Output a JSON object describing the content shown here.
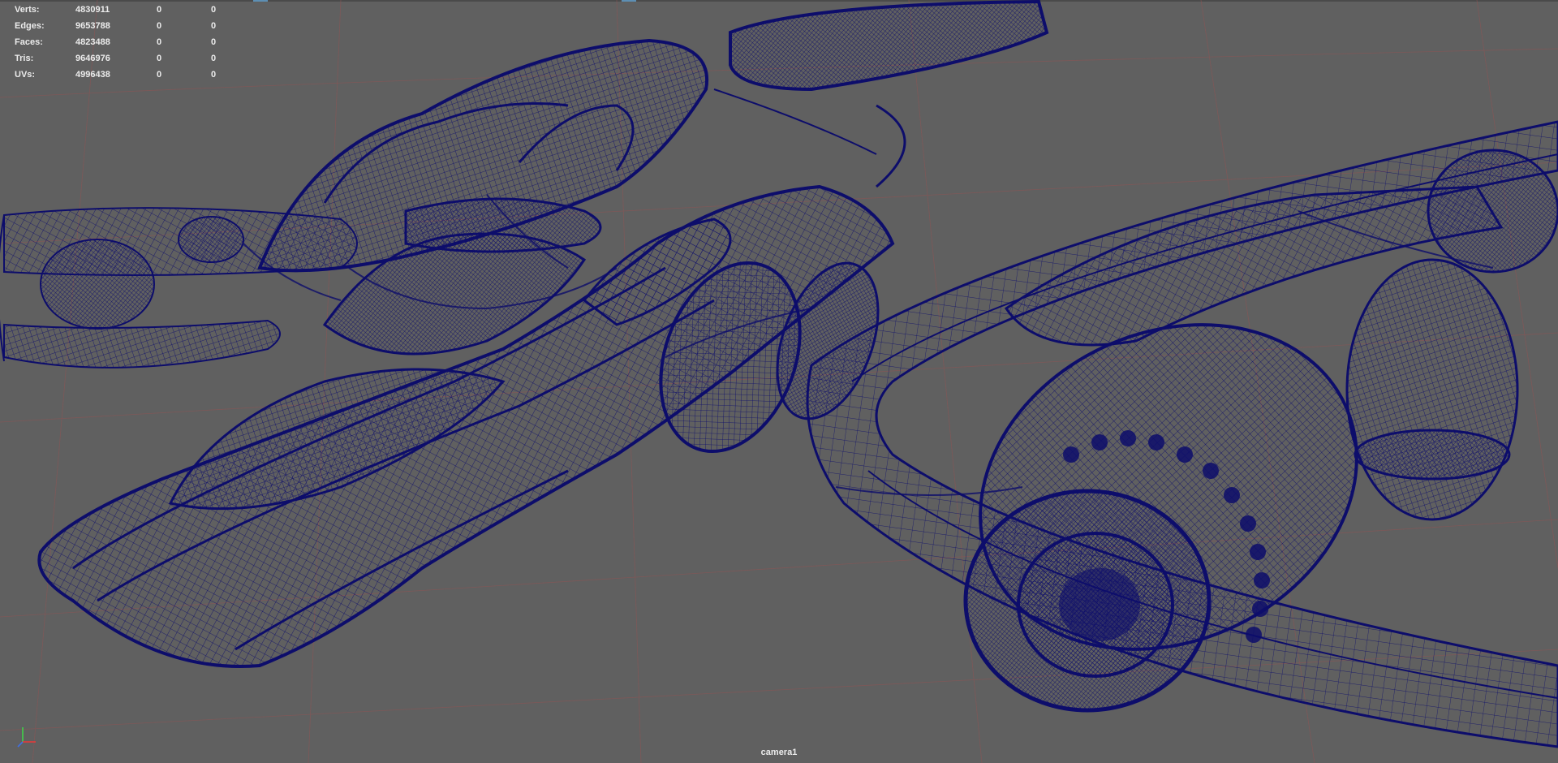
{
  "viewport": {
    "camera_name": "camera1",
    "background_color": "#606060",
    "wireframe_color": "#0d0d6b",
    "grid_line_color": "#8a5555"
  },
  "heads_up_display": {
    "rows": [
      {
        "label": "Verts:",
        "total": "4830911",
        "selected": "0",
        "component": "0"
      },
      {
        "label": "Edges:",
        "total": "9653788",
        "selected": "0",
        "component": "0"
      },
      {
        "label": "Faces:",
        "total": "4823488",
        "selected": "0",
        "component": "0"
      },
      {
        "label": "Tris:",
        "total": "9646976",
        "selected": "0",
        "component": "0"
      },
      {
        "label": "UVs:",
        "total": "4996438",
        "selected": "0",
        "component": "0"
      }
    ]
  },
  "axis_gizmo": {
    "x_color": "#e23b3b",
    "y_color": "#3fd14a",
    "z_color": "#3f6fe2"
  }
}
